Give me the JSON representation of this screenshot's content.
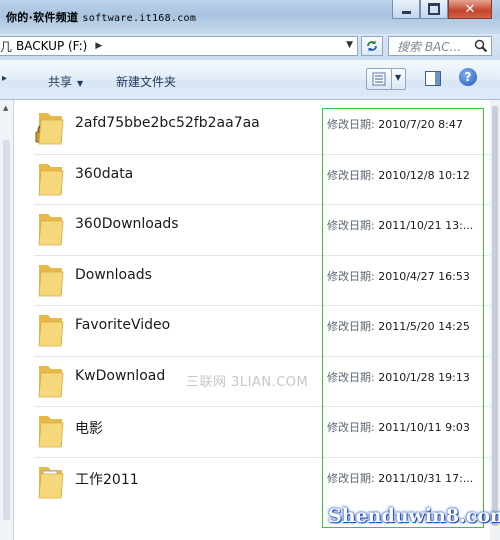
{
  "titlebar": {
    "watermark_text": "你的·软件频道",
    "watermark_site": "software.it168.com"
  },
  "window_controls": {
    "minimize": "minimize",
    "maximize": "maximize",
    "close": "✕"
  },
  "address": {
    "left_fragment": "几",
    "path": "BACKUP (F:)",
    "separator": "▶"
  },
  "search": {
    "placeholder": "搜索 BAC..."
  },
  "toolbar": {
    "share_label": "共享",
    "new_folder_label": "新建文件夹",
    "help_label": "?"
  },
  "files": {
    "date_label": "修改日期:",
    "items": [
      {
        "name": "2afd75bbe2bc52fb2aa7aa",
        "modified": "2010/7/20 8:47",
        "icon": "locked-folder-icon"
      },
      {
        "name": "360data",
        "modified": "2010/12/8 10:12",
        "icon": "folder-icon"
      },
      {
        "name": "360Downloads",
        "modified": "2011/10/21 13:...",
        "icon": "folder-icon"
      },
      {
        "name": "Downloads",
        "modified": "2010/4/27 16:53",
        "icon": "folder-icon"
      },
      {
        "name": "FavoriteVideo",
        "modified": "2011/5/20 14:25",
        "icon": "folder-icon"
      },
      {
        "name": "KwDownload",
        "modified": "2010/1/28 19:13",
        "icon": "folder-icon"
      },
      {
        "name": "电影",
        "modified": "2011/10/11 9:03",
        "icon": "folder-icon"
      },
      {
        "name": "工作2011",
        "modified": "2011/10/31 17:...",
        "icon": "documents-folder-icon"
      }
    ]
  },
  "watermarks": {
    "center": "三联网 3LIAN.COM",
    "bottom": "Shenduwin8.com"
  },
  "colors": {
    "highlight_box": "#3cc43c",
    "folder_yellow": "#f3d36b"
  }
}
